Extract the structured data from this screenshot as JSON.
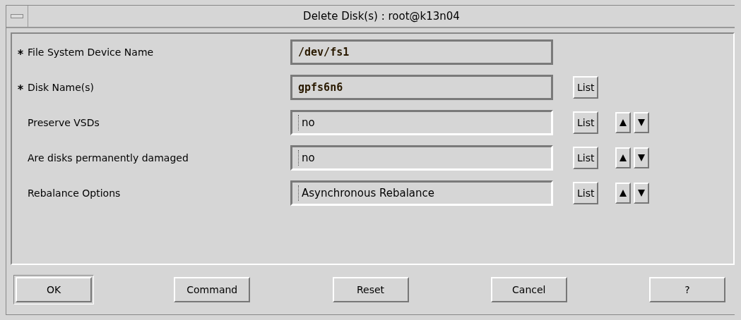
{
  "window": {
    "title": "Delete Disk(s) : root@k13n04"
  },
  "fields": [
    {
      "label": "File System Device Name",
      "required": true,
      "kind": "text",
      "value": "/dev/fs1"
    },
    {
      "label": "Disk Name(s)",
      "required": true,
      "kind": "text",
      "value": "gpfs6n6",
      "list_button": "List"
    },
    {
      "label": "Preserve VSDs",
      "required": false,
      "kind": "option",
      "value": "no",
      "list_button": "List"
    },
    {
      "label": "Are disks permanently damaged",
      "required": false,
      "kind": "option",
      "value": "no",
      "list_button": "List"
    },
    {
      "label": "Rebalance Options",
      "required": false,
      "kind": "option",
      "value": "Asynchronous Rebalance",
      "list_button": "List"
    }
  ],
  "buttons": [
    {
      "label": "OK",
      "default": true
    },
    {
      "label": "Command",
      "default": false
    },
    {
      "label": "Reset",
      "default": false
    },
    {
      "label": "Cancel",
      "default": false
    },
    {
      "label": "?",
      "default": false
    }
  ]
}
